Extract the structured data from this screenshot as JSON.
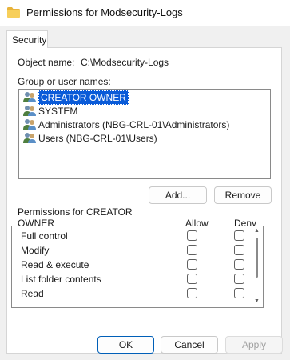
{
  "window": {
    "title": "Permissions for Modsecurity-Logs",
    "folder_icon": "folder-icon",
    "folder_color": "#f2c94c"
  },
  "tabs": [
    {
      "label": "Security"
    }
  ],
  "object": {
    "label": "Object name:",
    "value": "C:\\Modsecurity-Logs"
  },
  "group_section": {
    "label": "Group or user names:",
    "items": [
      {
        "name": "CREATOR OWNER",
        "selected": true
      },
      {
        "name": "SYSTEM",
        "selected": false
      },
      {
        "name": "Administrators (NBG-CRL-01\\Administrators)",
        "selected": false
      },
      {
        "name": "Users (NBG-CRL-01\\Users)",
        "selected": false
      }
    ],
    "add_label": "Add...",
    "remove_label": "Remove"
  },
  "permissions": {
    "heading_line1": "Permissions for CREATOR",
    "heading_line2": "OWNER",
    "allow_label": "Allow",
    "deny_label": "Deny",
    "rows": [
      {
        "name": "Full control",
        "allow": false,
        "deny": false
      },
      {
        "name": "Modify",
        "allow": false,
        "deny": false
      },
      {
        "name": "Read & execute",
        "allow": false,
        "deny": false
      },
      {
        "name": "List folder contents",
        "allow": false,
        "deny": false
      },
      {
        "name": "Read",
        "allow": false,
        "deny": false
      }
    ]
  },
  "footer": {
    "ok_label": "OK",
    "cancel_label": "Cancel",
    "apply_label": "Apply"
  },
  "colors": {
    "selection": "#0a5bd8",
    "accent_border": "#005fb8"
  }
}
